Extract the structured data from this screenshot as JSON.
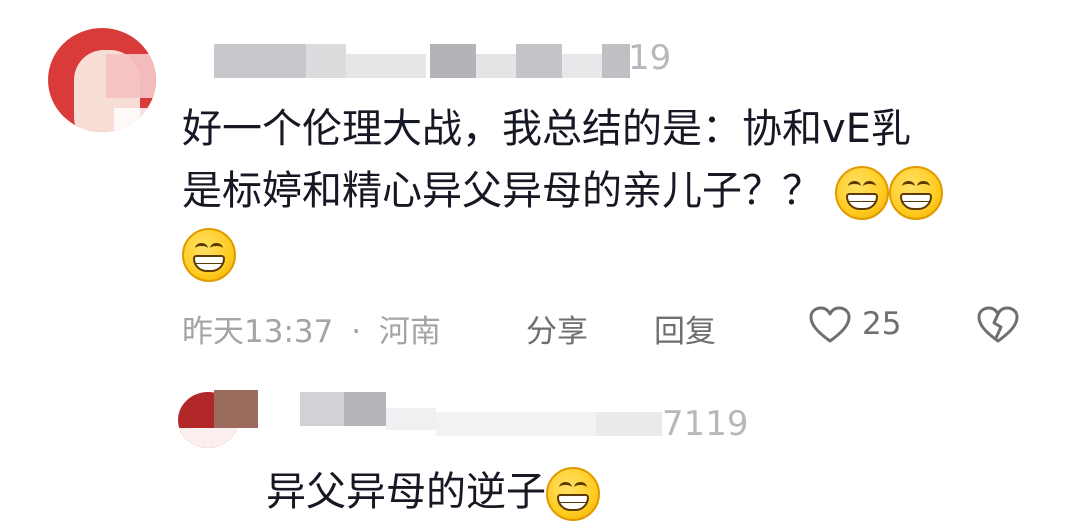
{
  "comment": {
    "username_suffix": "19",
    "text_line1": "好一个伦理大战，我总结的是：协和vE乳",
    "text_line2": "是标婷和精心异父异母的亲儿子？？",
    "emoji_names": [
      "grinning-face-icon",
      "grinning-face-icon",
      "grinning-face-icon"
    ],
    "time": "昨天13:37",
    "separator": "·",
    "location": "河南",
    "share_label": "分享",
    "reply_label": "回复",
    "like_count": "25"
  },
  "reply": {
    "username_suffix": "7119",
    "text": "异父异母的逆子"
  },
  "colors": {
    "text": "#161823",
    "muted": "#a4a4a8",
    "action": "#6e6e73"
  }
}
